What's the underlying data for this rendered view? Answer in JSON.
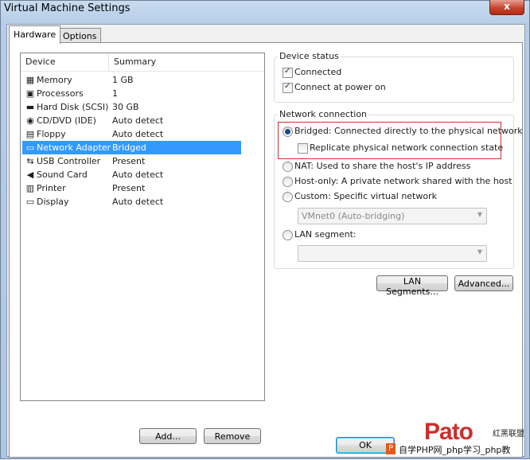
{
  "window": {
    "title": "Virtual Machine Settings",
    "close_glyph": "x"
  },
  "tabs": [
    {
      "label": "Hardware"
    },
    {
      "label": "Options"
    }
  ],
  "devices": {
    "col_device": "Device",
    "col_summary": "Summary",
    "items": [
      {
        "name": "Memory",
        "summary": "1 GB",
        "icon": "memory-icon",
        "glyph": "▦"
      },
      {
        "name": "Processors",
        "summary": "1",
        "icon": "processor-icon",
        "glyph": "▣"
      },
      {
        "name": "Hard Disk (SCSI)",
        "summary": "30 GB",
        "icon": "hard-disk-icon",
        "glyph": "▬"
      },
      {
        "name": "CD/DVD (IDE)",
        "summary": "Auto detect",
        "icon": "cd-dvd-icon",
        "glyph": "◉"
      },
      {
        "name": "Floppy",
        "summary": "Auto detect",
        "icon": "floppy-icon",
        "glyph": "▤"
      },
      {
        "name": "Network Adapter",
        "summary": "Bridged",
        "icon": "network-adapter-icon",
        "glyph": "▭"
      },
      {
        "name": "USB Controller",
        "summary": "Present",
        "icon": "usb-icon",
        "glyph": "⇆"
      },
      {
        "name": "Sound Card",
        "summary": "Auto detect",
        "icon": "speaker-icon",
        "glyph": "◀"
      },
      {
        "name": "Printer",
        "summary": "Present",
        "icon": "printer-icon",
        "glyph": "▥"
      },
      {
        "name": "Display",
        "summary": "Auto detect",
        "icon": "display-icon",
        "glyph": "▭"
      }
    ],
    "selected": "Network Adapter",
    "add_label": "Add...",
    "remove_label": "Remove"
  },
  "device_status": {
    "label": "Device status",
    "connected": {
      "label": "Connected",
      "checked": true
    },
    "connect_at_power_on": {
      "label": "Connect at power on",
      "checked": true
    }
  },
  "network_connection": {
    "label": "Network connection",
    "bridged": {
      "label": "Bridged: Connected directly to the physical network",
      "selected": true
    },
    "replicate": {
      "label": "Replicate physical network connection state",
      "checked": false
    },
    "nat": {
      "label": "NAT: Used to share the host's IP address",
      "selected": false
    },
    "host_only": {
      "label": "Host-only: A private network shared with the host",
      "selected": false
    },
    "custom": {
      "label": "Custom: Specific virtual network",
      "selected": false
    },
    "custom_value": "VMnet0 (Auto-bridging)",
    "lan_segment": {
      "label": "LAN segment:",
      "selected": false
    },
    "lan_segment_value": ""
  },
  "buttons": {
    "lan_segments": "LAN Segments...",
    "advanced": "Advanced...",
    "ok": "OK"
  },
  "watermark": {
    "logo": "Pato",
    "top_text": "红黑联盟",
    "bottom_text": "自学PHP网_php学习_php教"
  }
}
